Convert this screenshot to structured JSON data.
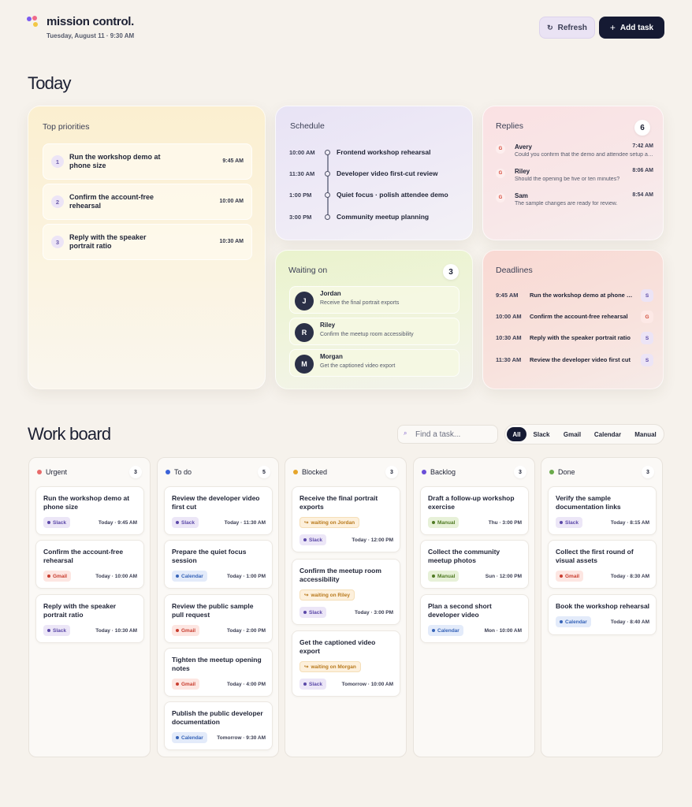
{
  "header": {
    "title": "mission control.",
    "date": "Tuesday, August 11 · 9:30 AM",
    "refresh_label": "Refresh",
    "add_label": "Add task"
  },
  "today": {
    "heading": "Today"
  },
  "priorities": {
    "title": "Top priorities",
    "items": [
      {
        "num": "1",
        "text": "Run the workshop demo at phone size",
        "time": "9:45 AM"
      },
      {
        "num": "2",
        "text": "Confirm the account-free rehearsal",
        "time": "10:00 AM"
      },
      {
        "num": "3",
        "text": "Reply with the speaker portrait ratio",
        "time": "10:30 AM"
      }
    ]
  },
  "schedule": {
    "title": "Schedule",
    "items": [
      {
        "time": "10:00 AM",
        "text": "Frontend workshop rehearsal"
      },
      {
        "time": "11:30 AM",
        "text": "Developer video first-cut review"
      },
      {
        "time": "1:00 PM",
        "text": "Quiet focus · polish attendee demo"
      },
      {
        "time": "3:00 PM",
        "text": "Community meetup planning"
      }
    ]
  },
  "replies": {
    "title": "Replies",
    "count": "6",
    "items": [
      {
        "icon": "G",
        "name": "Avery",
        "time": "7:42 AM",
        "msg": "Could you confirm that the demo and attendee setup are ready?"
      },
      {
        "icon": "G",
        "name": "Riley",
        "time": "8:06 AM",
        "msg": "Should the opening be five or ten minutes?"
      },
      {
        "icon": "G",
        "name": "Sam",
        "time": "8:54 AM",
        "msg": "The sample changes are ready for review."
      }
    ]
  },
  "waiting": {
    "title": "Waiting on",
    "count": "3",
    "items": [
      {
        "initial": "J",
        "name": "Jordan",
        "msg": "Receive the final portrait exports"
      },
      {
        "initial": "R",
        "name": "Riley",
        "msg": "Confirm the meetup room accessibility"
      },
      {
        "initial": "M",
        "name": "Morgan",
        "msg": "Get the captioned video export"
      }
    ]
  },
  "deadlines": {
    "title": "Deadlines",
    "items": [
      {
        "time": "9:45 AM",
        "text": "Run the workshop demo at phone size",
        "src": "S"
      },
      {
        "time": "10:00 AM",
        "text": "Confirm the account-free rehearsal",
        "src": "G"
      },
      {
        "time": "10:30 AM",
        "text": "Reply with the speaker portrait ratio",
        "src": "S"
      },
      {
        "time": "11:30 AM",
        "text": "Review the developer video first cut",
        "src": "S"
      }
    ]
  },
  "board": {
    "heading": "Work board",
    "search_placeholder": "Find a task...",
    "filters": [
      "All",
      "Slack",
      "Gmail",
      "Calendar",
      "Manual"
    ],
    "columns": [
      {
        "title": "Urgent",
        "count": "3",
        "color": "#e86a6a",
        "tasks": [
          {
            "title": "Run the workshop demo at phone size",
            "tag": "Slack",
            "time": "Today · 9:45 AM"
          },
          {
            "title": "Confirm the account-free rehearsal",
            "tag": "Gmail",
            "time": "Today · 10:00 AM"
          },
          {
            "title": "Reply with the speaker portrait ratio",
            "tag": "Slack",
            "time": "Today · 10:30 AM"
          }
        ]
      },
      {
        "title": "To do",
        "count": "5",
        "color": "#3a62d8",
        "tasks": [
          {
            "title": "Review the developer video first cut",
            "tag": "Slack",
            "time": "Today · 11:30 AM"
          },
          {
            "title": "Prepare the quiet focus session",
            "tag": "Calendar",
            "time": "Today · 1:00 PM"
          },
          {
            "title": "Review the public sample pull request",
            "tag": "Gmail",
            "time": "Today · 2:00 PM"
          },
          {
            "title": "Tighten the meetup opening notes",
            "tag": "Gmail",
            "time": "Today · 4:00 PM"
          },
          {
            "title": "Publish the public developer documentation",
            "tag": "Calendar",
            "time": "Tomorrow · 9:30 AM"
          }
        ]
      },
      {
        "title": "Blocked",
        "count": "3",
        "color": "#e6a52a",
        "tasks": [
          {
            "title": "Receive the final portrait exports",
            "wait": "waiting on Jordan",
            "tag": "Slack",
            "time": "Today · 12:00 PM"
          },
          {
            "title": "Confirm the meetup room accessibility",
            "wait": "waiting on Riley",
            "tag": "Slack",
            "time": "Today · 3:00 PM"
          },
          {
            "title": "Get the captioned video export",
            "wait": "waiting on Morgan",
            "tag": "Slack",
            "time": "Tomorrow · 10:00 AM"
          }
        ]
      },
      {
        "title": "Backlog",
        "count": "3",
        "color": "#6a4fd8",
        "tasks": [
          {
            "title": "Draft a follow-up workshop exercise",
            "tag": "Manual",
            "time": "Thu · 3:00 PM"
          },
          {
            "title": "Collect the community meetup photos",
            "tag": "Manual",
            "time": "Sun · 12:00 PM"
          },
          {
            "title": "Plan a second short developer video",
            "tag": "Calendar",
            "time": "Mon · 10:00 AM"
          }
        ]
      },
      {
        "title": "Done",
        "count": "3",
        "color": "#6aaa4a",
        "tasks": [
          {
            "title": "Verify the sample documentation links",
            "tag": "Slack",
            "time": "Today · 8:15 AM"
          },
          {
            "title": "Collect the first round of visual assets",
            "tag": "Gmail",
            "time": "Today · 8:30 AM"
          },
          {
            "title": "Book the workshop rehearsal",
            "tag": "Calendar",
            "time": "Today · 8:40 AM"
          }
        ]
      }
    ]
  }
}
